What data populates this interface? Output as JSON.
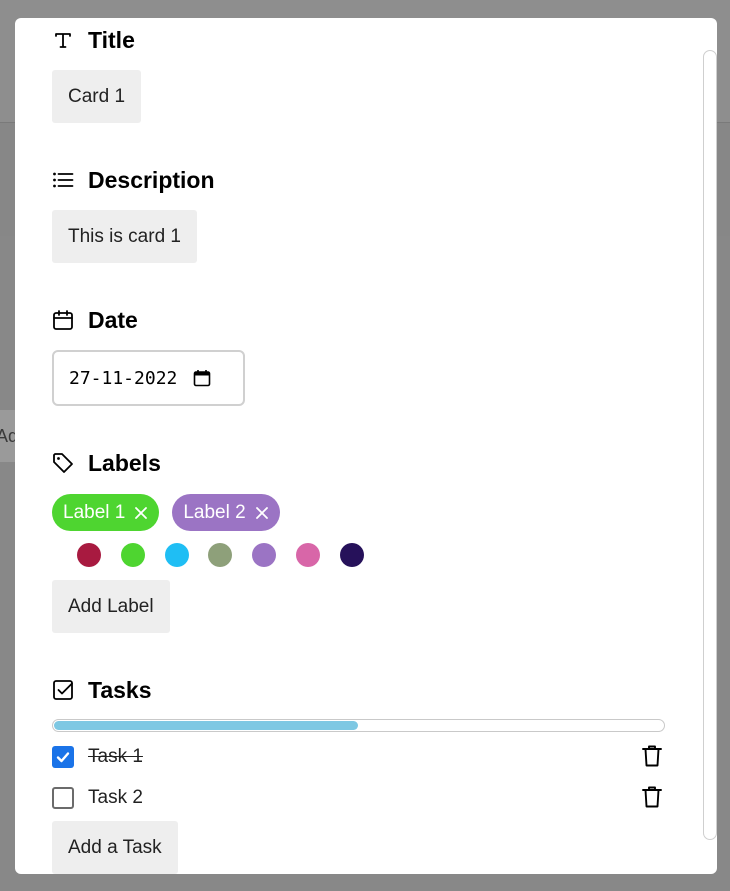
{
  "background": {
    "stub_text": "Ad"
  },
  "modal": {
    "title_section": {
      "heading": "Title",
      "value": "Card 1"
    },
    "description_section": {
      "heading": "Description",
      "value": "This is card 1"
    },
    "date_section": {
      "heading": "Date",
      "value": "27-11-2022"
    },
    "labels_section": {
      "heading": "Labels",
      "labels": [
        {
          "text": "Label 1",
          "color": "#4ed530"
        },
        {
          "text": "Label 2",
          "color": "#9b74c4"
        }
      ],
      "color_options": [
        "#a81a40",
        "#4ed530",
        "#1fbef4",
        "#8ea07a",
        "#9b74c4",
        "#d866a8",
        "#26115a"
      ],
      "add_button": "Add Label"
    },
    "tasks_section": {
      "heading": "Tasks",
      "progress": 0.5,
      "progress_color": "#7ec8e3",
      "tasks": [
        {
          "text": "Task 1",
          "done": true
        },
        {
          "text": "Task 2",
          "done": false
        }
      ],
      "add_button": "Add a Task"
    }
  }
}
